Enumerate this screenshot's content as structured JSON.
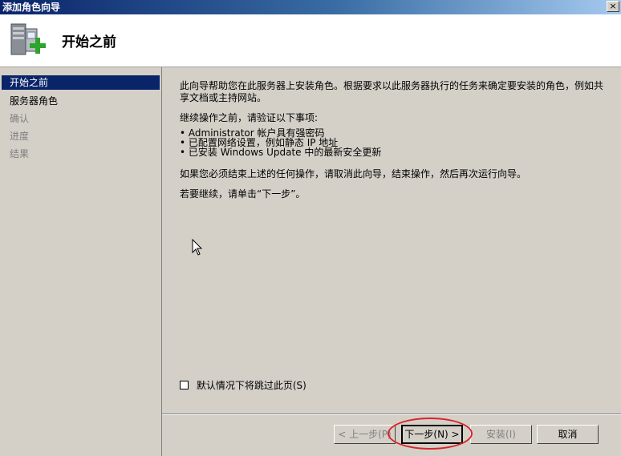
{
  "window": {
    "title": "添加角色向导",
    "close_label": "×"
  },
  "header": {
    "page_title": "开始之前"
  },
  "nav": {
    "items": [
      {
        "label": "开始之前",
        "state": "active"
      },
      {
        "label": "服务器角色",
        "state": "enabled"
      },
      {
        "label": "确认",
        "state": "disabled"
      },
      {
        "label": "进度",
        "state": "disabled"
      },
      {
        "label": "结果",
        "state": "disabled"
      }
    ]
  },
  "content": {
    "intro_line1": "此向导帮助您在此服务器上安装角色。根据要求以此服务器执行的任务来确定要安装的角色，例如共",
    "intro_line2": "享文档或主持网站。",
    "verify_heading": "继续操作之前，请验证以下事项:",
    "bullets": [
      "• Administrator 帐户具有强密码",
      "• 已配置网络设置，例如静态 IP 地址",
      "• 已安装 Windows Update 中的最新安全更新"
    ],
    "cancel_note": "如果您必须结束上述的任何操作，请取消此向导，结束操作，然后再次运行向导。",
    "continue_note": "若要继续，请单击“下一步”。",
    "skip_checkbox_label": "默认情况下将跳过此页(S)",
    "skip_checked": false
  },
  "buttons": {
    "back": "< 上一步(P)",
    "next": "下一步(N) >",
    "install": "安装(I)",
    "cancel": "取消"
  },
  "colors": {
    "nav_active": "#0a246a",
    "annotation": "#d8242a",
    "dialog_bg": "#d4d0c8"
  }
}
